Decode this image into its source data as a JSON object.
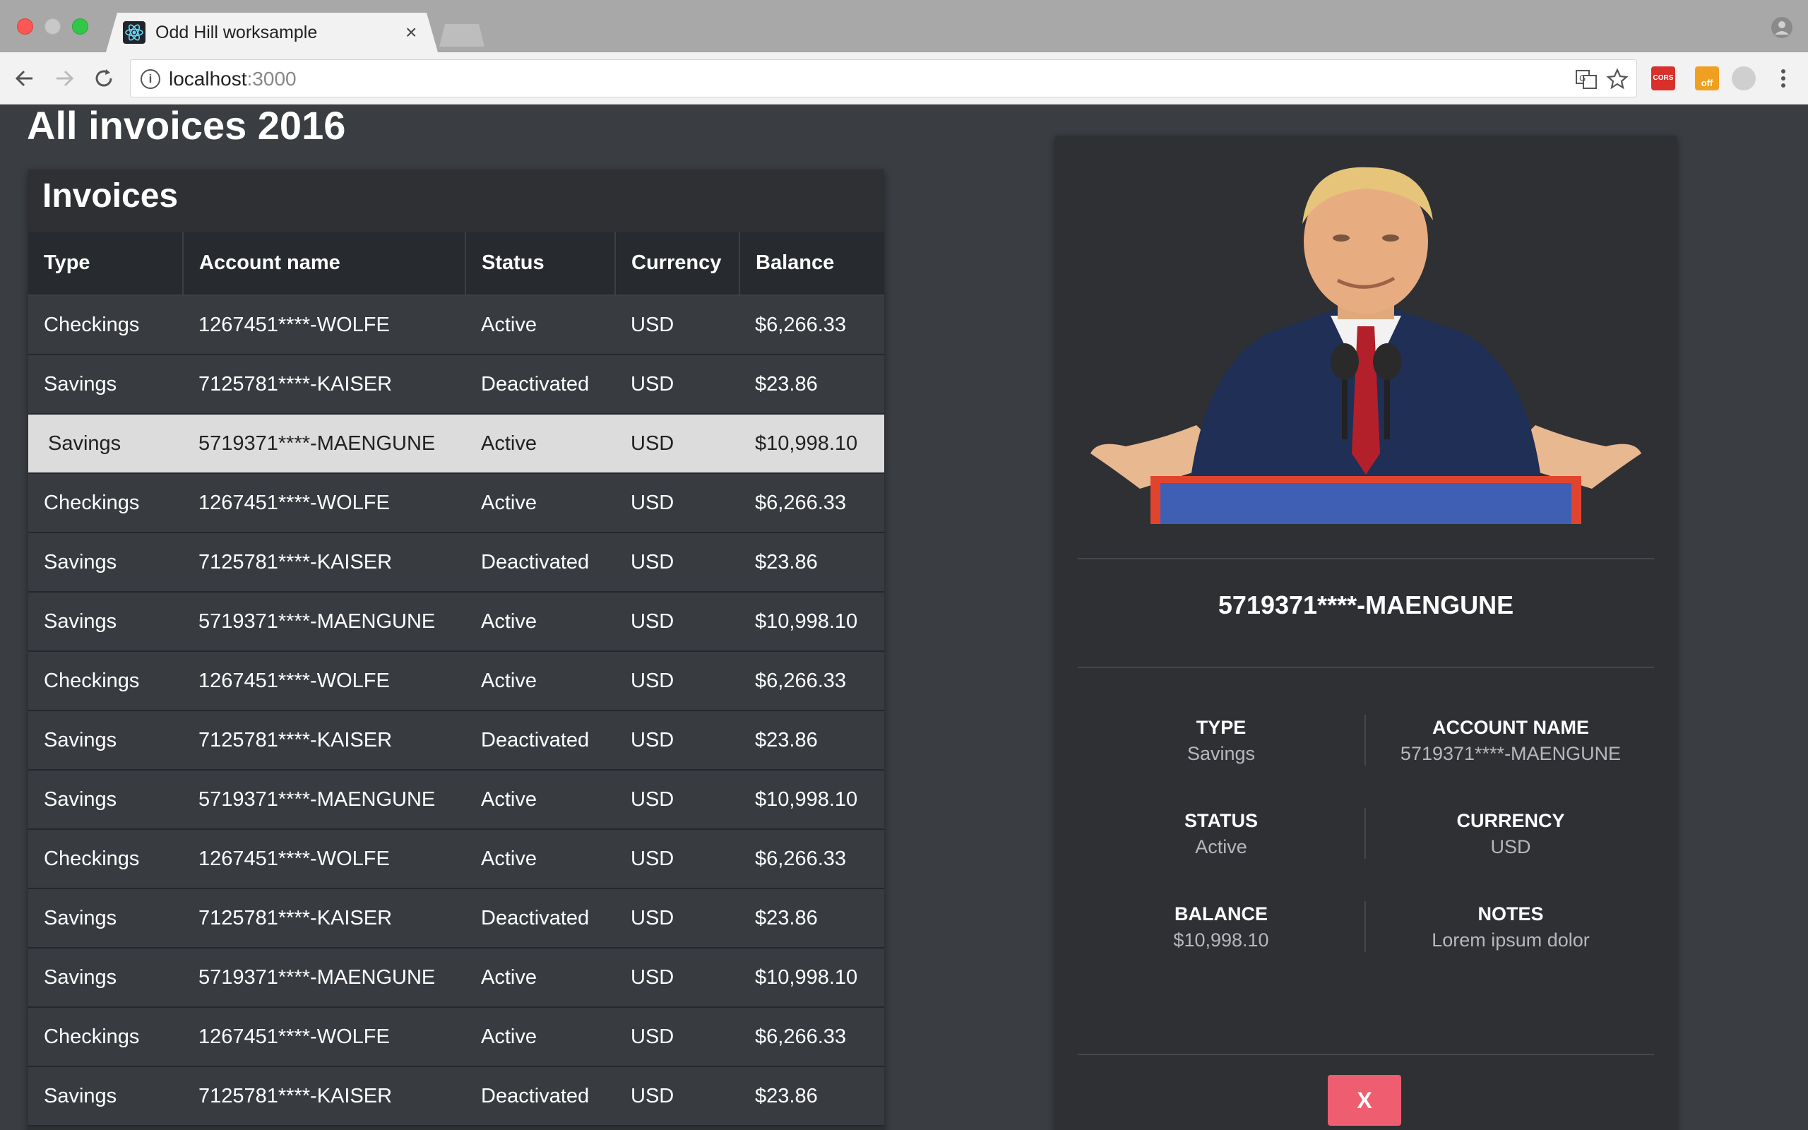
{
  "browser": {
    "tab_title": "Odd Hill worksample",
    "tab_close": "×",
    "url_host": "localhost",
    "url_port": ":3000",
    "extension_cors": "CORS",
    "extension_off": "off"
  },
  "page": {
    "title": "All invoices 2016"
  },
  "invoices": {
    "title": "Invoices",
    "columns": [
      "Type",
      "Account name",
      "Status",
      "Currency",
      "Balance"
    ],
    "rows": [
      [
        "Checkings",
        "1267451****-WOLFE",
        "Active",
        "USD",
        "$6,266.33"
      ],
      [
        "Savings",
        "7125781****-KAISER",
        "Deactivated",
        "USD",
        "$23.86"
      ],
      [
        "Savings",
        "5719371****-MAENGUNE",
        "Active",
        "USD",
        "$10,998.10"
      ],
      [
        "Checkings",
        "1267451****-WOLFE",
        "Active",
        "USD",
        "$6,266.33"
      ],
      [
        "Savings",
        "7125781****-KAISER",
        "Deactivated",
        "USD",
        "$23.86"
      ],
      [
        "Savings",
        "5719371****-MAENGUNE",
        "Active",
        "USD",
        "$10,998.10"
      ],
      [
        "Checkings",
        "1267451****-WOLFE",
        "Active",
        "USD",
        "$6,266.33"
      ],
      [
        "Savings",
        "7125781****-KAISER",
        "Deactivated",
        "USD",
        "$23.86"
      ],
      [
        "Savings",
        "5719371****-MAENGUNE",
        "Active",
        "USD",
        "$10,998.10"
      ],
      [
        "Checkings",
        "1267451****-WOLFE",
        "Active",
        "USD",
        "$6,266.33"
      ],
      [
        "Savings",
        "7125781****-KAISER",
        "Deactivated",
        "USD",
        "$23.86"
      ],
      [
        "Savings",
        "5719371****-MAENGUNE",
        "Active",
        "USD",
        "$10,998.10"
      ],
      [
        "Checkings",
        "1267451****-WOLFE",
        "Active",
        "USD",
        "$6,266.33"
      ],
      [
        "Savings",
        "7125781****-KAISER",
        "Deactivated",
        "USD",
        "$23.86"
      ]
    ],
    "selected_row": 2
  },
  "detail": {
    "account_name": "5719371****-MAENGUNE",
    "fields": {
      "type_label": "TYPE",
      "type_value": "Savings",
      "account_label": "ACCOUNT NAME",
      "account_value": "5719371****-MAENGUNE",
      "status_label": "STATUS",
      "status_value": "Active",
      "currency_label": "CURRENCY",
      "currency_value": "USD",
      "balance_label": "BALANCE",
      "balance_value": "$10,998.10",
      "notes_label": "NOTES",
      "notes_value": "Lorem ipsum dolor"
    },
    "close_label": "X"
  }
}
